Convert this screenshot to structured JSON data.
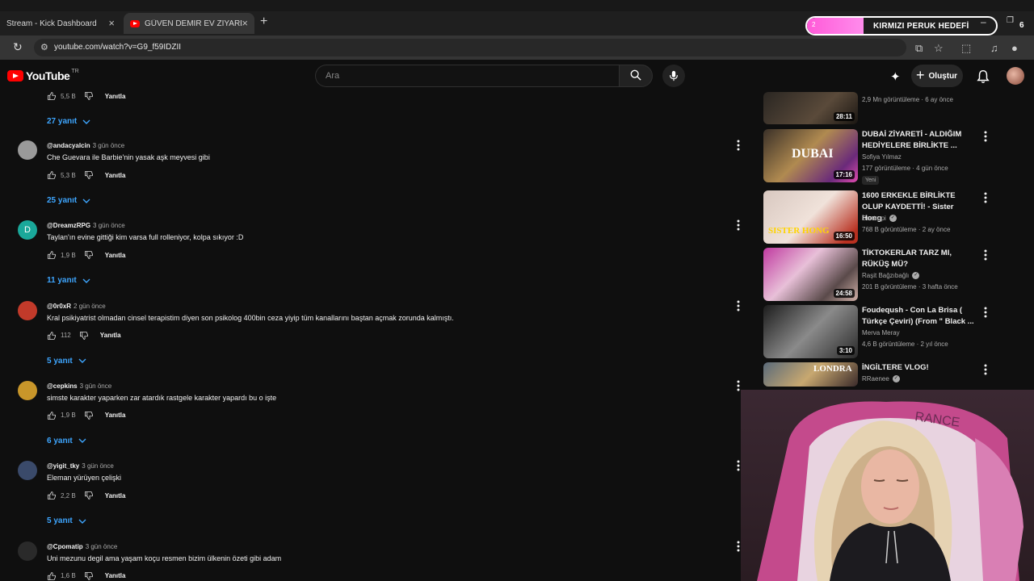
{
  "browser": {
    "tabs": [
      {
        "label": "Stream - Kick Dashboard",
        "active": false
      },
      {
        "label": "GÜVEN DEMİR EV ZİYARETİ - Yo",
        "active": true
      }
    ],
    "url": "youtube.com/watch?v=G9_f59IDZII"
  },
  "overlay": {
    "goal_label": "KIRMIZI PERUK HEDEFİ",
    "goal_current": "2",
    "goal_target": "6",
    "goal_progress": 0.3
  },
  "youtube": {
    "logo_text": "YouTube",
    "country": "TR",
    "search_placeholder": "Ara",
    "create_label": "Oluştur"
  },
  "comments": {
    "top": {
      "likes": "5,5 B",
      "reply_label": "Yanıtla",
      "replies": "27 yanıt"
    },
    "items": [
      {
        "author": "@andacyalcin",
        "time": "3 gün önce",
        "text": "Che Guevara ile Barbie'nin yasak aşk meyvesi gibi",
        "likes": "5,3 B",
        "reply_label": "Yanıtla",
        "replies": "25 yanıt",
        "avatar_color": "#9a9a9a",
        "initial": ""
      },
      {
        "author": "@DreamzRPG",
        "time": "3 gün önce",
        "text": "Taylan'ın evine gittiği kim varsa full rolleniyor, kolpa sıkıyor :D",
        "likes": "1,9 B",
        "reply_label": "Yanıtla",
        "replies": "11 yanıt",
        "avatar_color": "#1aa89a",
        "initial": "D"
      },
      {
        "author": "@0r0xR",
        "time": "2 gün önce",
        "text": "Kral psikiyatrist olmadan cinsel terapistim diyen son psikolog 400bin ceza yiyip tüm kanallarını baştan açmak zorunda kalmıştı.",
        "likes": "112",
        "reply_label": "Yanıtla",
        "replies": "5 yanıt",
        "avatar_color": "#c23a2a",
        "initial": ""
      },
      {
        "author": "@cepkins",
        "time": "3 gün önce",
        "text": "simste karakter yaparken zar atardık rastgele karakter yapardı bu o işte",
        "likes": "1,9 B",
        "reply_label": "Yanıtla",
        "replies": "6 yanıt",
        "avatar_color": "#c8962a",
        "initial": ""
      },
      {
        "author": "@yigit_tky",
        "time": "3 gün önce",
        "text": "Eleman yürüyen çelişki",
        "likes": "2,2 B",
        "reply_label": "Yanıtla",
        "replies": "5 yanıt",
        "avatar_color": "#3a4a6a",
        "initial": ""
      },
      {
        "author": "@Cpomatip",
        "time": "3 gün önce",
        "text": "Uni mezunu degil ama yaşam koçu resmen bizim ülkenin özeti gibi adam",
        "likes": "1,6 B",
        "reply_label": "Yanıtla",
        "replies": "",
        "avatar_color": "#2a2a2a",
        "initial": ""
      }
    ]
  },
  "recommendations": [
    {
      "title": "",
      "channel": "",
      "verified": false,
      "meta": "2,9 Mn görüntüleme · 6 ay önce",
      "duration": "28:11",
      "badge": ""
    },
    {
      "title": "DUBAİ ZİYARETİ - ALDIĞIM HEDİYELERE BİRLİKTE ...",
      "channel": "Sofiya Yılmaz",
      "verified": false,
      "meta": "177 görüntüleme · 4 gün önce",
      "duration": "17:16",
      "badge": "Yeni",
      "thumb_text": "DUBAI"
    },
    {
      "title": "1600 ERKEKLE BİRLİKTE OLUP KAYDETTİ! - Sister Hong",
      "channel": "Bentropi",
      "verified": true,
      "meta": "768 B görüntüleme · 2 ay önce",
      "duration": "16:50",
      "badge": "",
      "thumb_text": "SISTER HONG"
    },
    {
      "title": "TİKTOKERLAR TARZ MI, RÜKÜŞ MÜ?",
      "channel": "Raşit Bağzıbağlı",
      "verified": true,
      "meta": "201 B görüntüleme · 3 hafta önce",
      "duration": "24:58",
      "badge": ""
    },
    {
      "title": "Foudeqush - Con La Brisa ( Türkçe Çeviri) (From \" Black ...",
      "channel": "Merva Meray",
      "verified": false,
      "meta": "4,6 B görüntüleme · 2 yıl önce",
      "duration": "3:10",
      "badge": ""
    },
    {
      "title": "İNGİLTERE VLOG!",
      "channel": "RRaenee",
      "verified": true,
      "meta": "",
      "duration": "",
      "badge": "",
      "thumb_text": "LONDRA"
    }
  ],
  "colors": {
    "accent_link": "#3ea6ff",
    "brand_red": "#ff0000",
    "goal_pink": "#ff5ad8"
  }
}
